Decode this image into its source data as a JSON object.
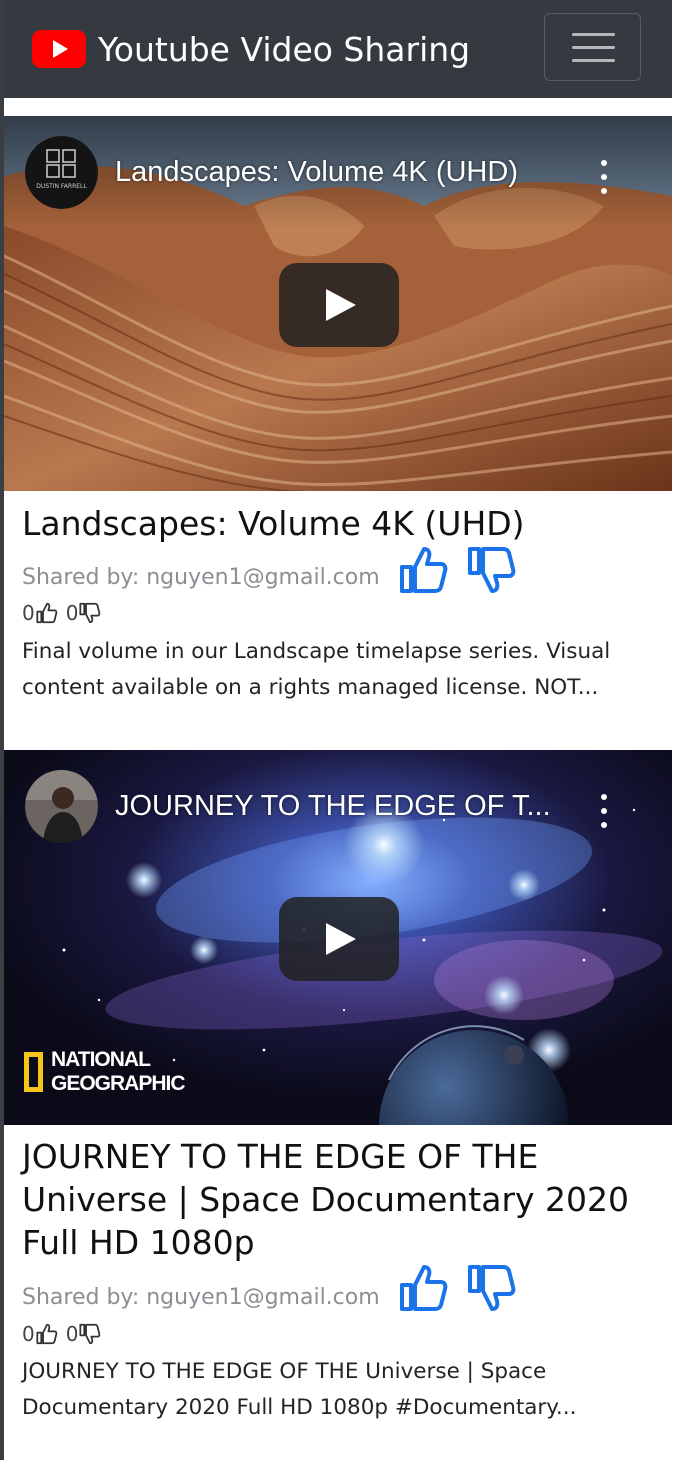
{
  "navbar": {
    "brand_title": "Youtube Video Sharing",
    "brand_color": "#ff0000",
    "bg_color": "#343a40",
    "menu_icon": "hamburger-menu-icon"
  },
  "videos": [
    {
      "embed_title": "Landscapes: Volume 4K (UHD)",
      "channel_text": "DUSTIN FARRELL",
      "title": "Landscapes: Volume 4K (UHD)",
      "shared_by": "Shared by: nguyen1@gmail.com",
      "likes": "0",
      "dislikes": "0",
      "description": "Final volume in our Landscape timelapse series. Visual content available on a rights managed license. NOT..."
    },
    {
      "embed_title": "JOURNEY TO THE EDGE OF T...",
      "logo_line1": "NATIONAL",
      "logo_line2": "GEOGRAPHIC",
      "title": "JOURNEY TO THE EDGE OF THE Universe | Space Documentary 2020 Full HD 1080p",
      "shared_by": "Shared by: nguyen1@gmail.com",
      "likes": "0",
      "dislikes": "0",
      "description": "JOURNEY TO THE EDGE OF THE Universe | Space Documentary 2020 Full HD 1080p #Documentary..."
    }
  ],
  "accent_color": "#1a73e8"
}
